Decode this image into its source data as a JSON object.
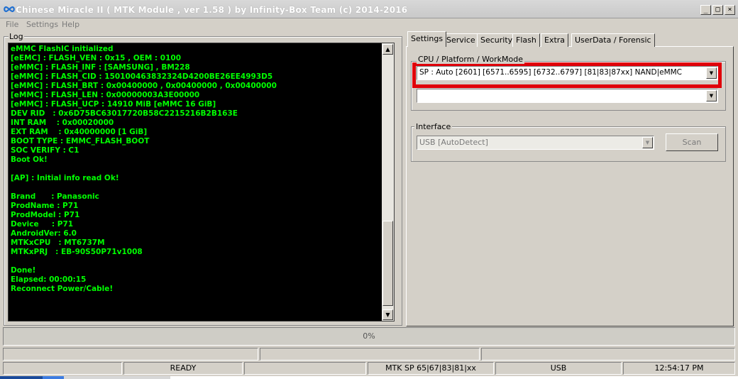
{
  "window": {
    "title": "Chinese Miracle II ( MTK Module , ver 1.58 ) by Infinity-Box Team (c) 2014-2016",
    "controls": {
      "minimize": "_",
      "maximize": "□",
      "close": "×"
    }
  },
  "menu": {
    "items": [
      "File",
      "Settings",
      "Help"
    ]
  },
  "log": {
    "label": "Log",
    "lines": [
      "eMMC FlashIC initialized",
      "[eEMC] : FLASH_VEN : 0x15 , OEM : 0100",
      "[eMMC] : FLASH_INF : [SAMSUNG] , BM228",
      "[eMMC] : FLASH_CID : 150100463832324D4200BE26EE4993D5",
      "[eMMC] : FLASH_BRT : 0x00400000 , 0x00400000 , 0x00400000",
      "[eMMC] : FLASH_LEN : 0x00000003A3E00000",
      "[eMMC] : FLASH_UCP : 14910 MiB [eMMC 16 GiB]",
      "DEV RID   : 0x6D75BC63017720B58C2215216B2B163E",
      "INT RAM    : 0x00020000",
      "EXT RAM    : 0x40000000 [1 GiB]",
      "BOOT TYPE : EMMC_FLASH_BOOT",
      "SOC VERIFY : C1",
      "Boot Ok!",
      "",
      "[AP] : Initial info read Ok!",
      "",
      "Brand      : Panasonic",
      "ProdName : P71",
      "ProdModel : P71",
      "Device     : P71",
      "AndroidVer: 6.0",
      "MTKxCPU   : MT6737M",
      "MTKxPRJ   : EB-90S50P71v1008",
      "",
      "Done!",
      "Elapsed: 00:00:15",
      "Reconnect Power/Cable!"
    ]
  },
  "tabs": [
    "Settings",
    "Service",
    "Security",
    "Flash",
    "Extra",
    "UserData / Forensic"
  ],
  "settings": {
    "cpu_group_label": "CPU / Platform / WorkMode",
    "cpu_select": "SP : Auto [2601] [6571..6595] [6732..6797] [81|83|87xx]  NAND|eMMC",
    "second_select": "",
    "interface_label": "Interface",
    "interface_select": "USB [AutoDetect]",
    "scan_label": "Scan"
  },
  "progress": {
    "text": "0%",
    "value": 0
  },
  "status": {
    "ready": "READY",
    "platform": "MTK SP 65|67|83|81|xx",
    "interface": "USB",
    "time": "12:54:17 PM"
  },
  "colors": {
    "window_bg": "#d4d0c8",
    "log_bg": "#000000",
    "log_text": "#00ff00",
    "highlight": "#e0000a"
  }
}
